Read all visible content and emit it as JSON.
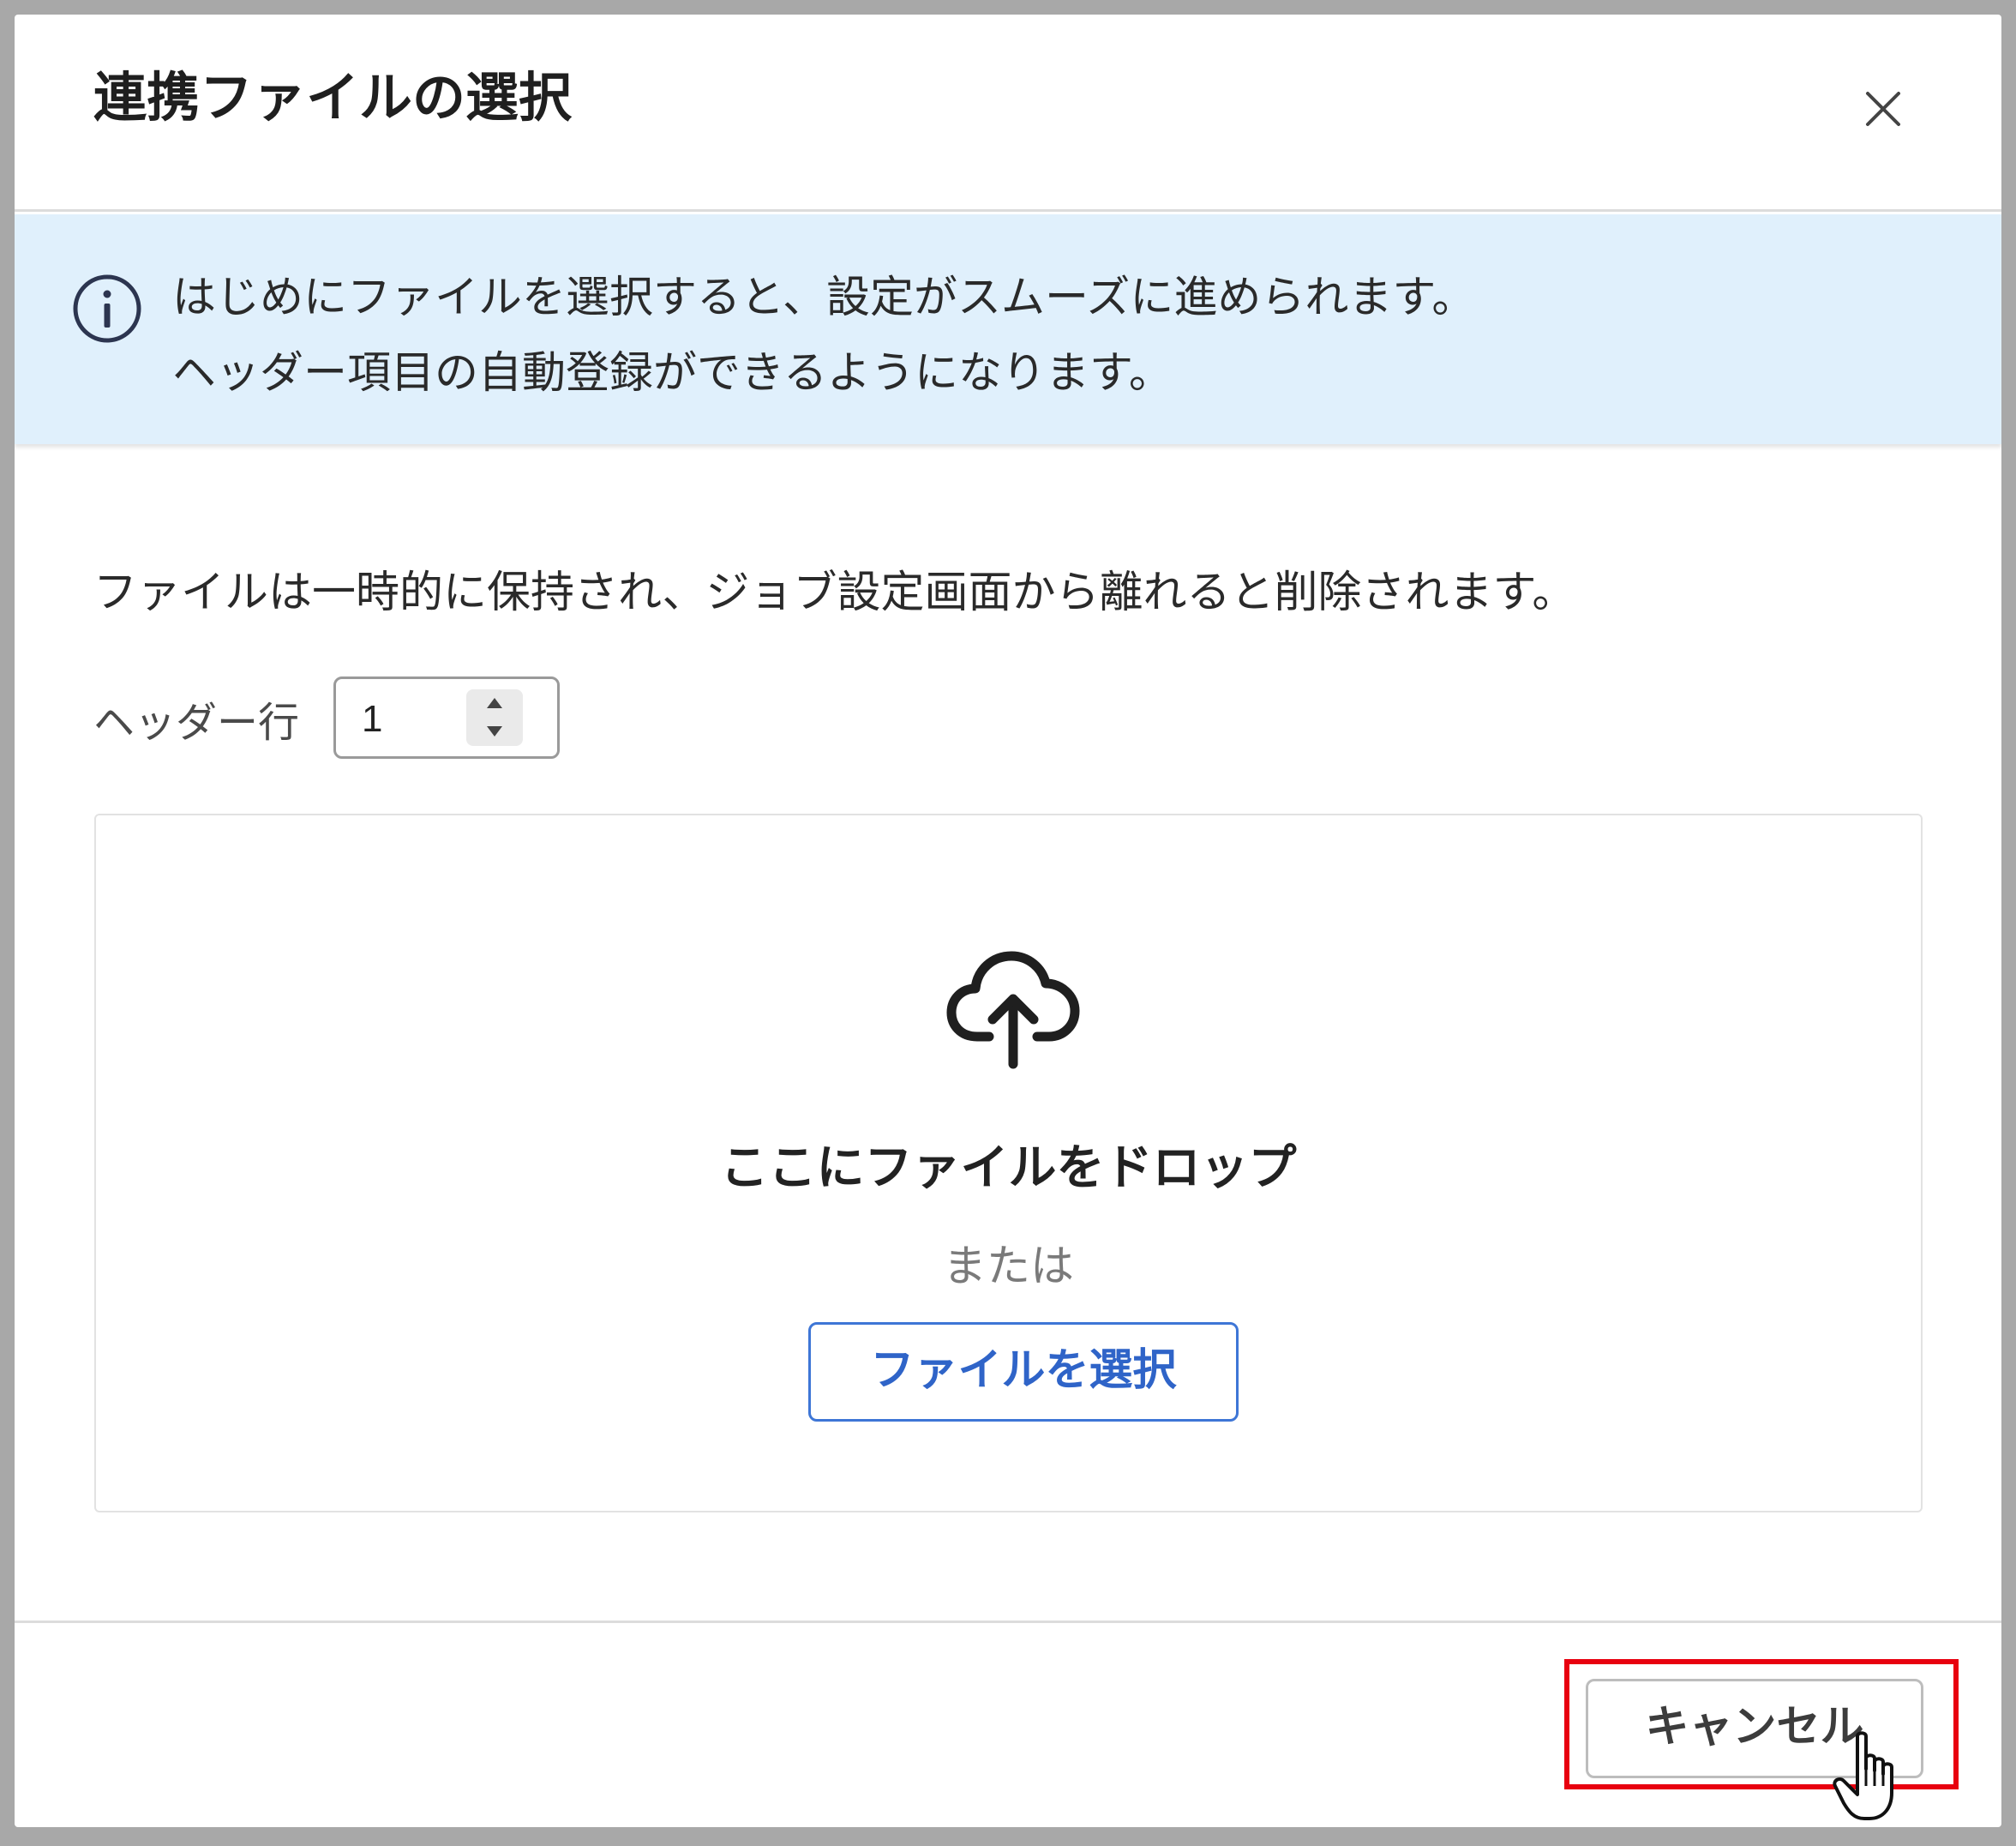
{
  "dialog": {
    "title": "連携ファイルの選択",
    "close_icon": "close-icon"
  },
  "info": {
    "icon": "info-icon",
    "line1": "はじめにファイルを選択すると、設定がスムーズに進められます。",
    "line2": "ヘッダー項目の自動登録ができるようになります。"
  },
  "body": {
    "description": "ファイルは一時的に保持され、ジョブ設定画面から離れると削除されます。",
    "header_row": {
      "label": "ヘッダー行",
      "value": "1"
    }
  },
  "drop_zone": {
    "icon": "cloud-upload-icon",
    "title": "ここにファイルをドロップ",
    "or_text": "または",
    "select_button": "ファイルを選択"
  },
  "footer": {
    "cancel_button": "キャンセル"
  },
  "colors": {
    "banner_bg": "#e0f0fc",
    "accent_blue": "#2f64c8",
    "highlight_red": "#e8000f"
  }
}
